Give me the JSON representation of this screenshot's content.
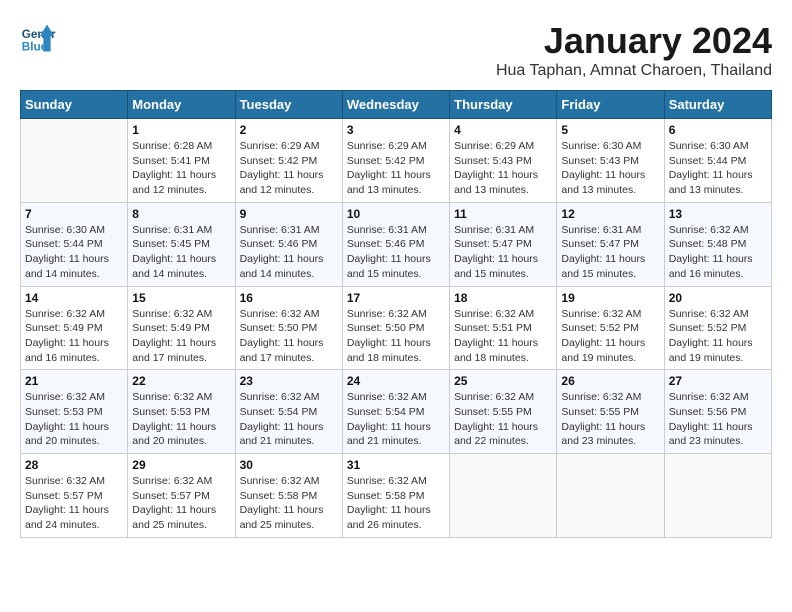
{
  "header": {
    "logo_line1": "General",
    "logo_line2": "Blue",
    "month": "January 2024",
    "location": "Hua Taphan, Amnat Charoen, Thailand"
  },
  "days_of_week": [
    "Sunday",
    "Monday",
    "Tuesday",
    "Wednesday",
    "Thursday",
    "Friday",
    "Saturday"
  ],
  "weeks": [
    [
      {
        "day": null
      },
      {
        "day": 1,
        "sunrise": "6:28 AM",
        "sunset": "5:41 PM",
        "daylight": "11 hours and 12 minutes."
      },
      {
        "day": 2,
        "sunrise": "6:29 AM",
        "sunset": "5:42 PM",
        "daylight": "11 hours and 12 minutes."
      },
      {
        "day": 3,
        "sunrise": "6:29 AM",
        "sunset": "5:42 PM",
        "daylight": "11 hours and 13 minutes."
      },
      {
        "day": 4,
        "sunrise": "6:29 AM",
        "sunset": "5:43 PM",
        "daylight": "11 hours and 13 minutes."
      },
      {
        "day": 5,
        "sunrise": "6:30 AM",
        "sunset": "5:43 PM",
        "daylight": "11 hours and 13 minutes."
      },
      {
        "day": 6,
        "sunrise": "6:30 AM",
        "sunset": "5:44 PM",
        "daylight": "11 hours and 13 minutes."
      }
    ],
    [
      {
        "day": 7,
        "sunrise": "6:30 AM",
        "sunset": "5:44 PM",
        "daylight": "11 hours and 14 minutes."
      },
      {
        "day": 8,
        "sunrise": "6:31 AM",
        "sunset": "5:45 PM",
        "daylight": "11 hours and 14 minutes."
      },
      {
        "day": 9,
        "sunrise": "6:31 AM",
        "sunset": "5:46 PM",
        "daylight": "11 hours and 14 minutes."
      },
      {
        "day": 10,
        "sunrise": "6:31 AM",
        "sunset": "5:46 PM",
        "daylight": "11 hours and 15 minutes."
      },
      {
        "day": 11,
        "sunrise": "6:31 AM",
        "sunset": "5:47 PM",
        "daylight": "11 hours and 15 minutes."
      },
      {
        "day": 12,
        "sunrise": "6:31 AM",
        "sunset": "5:47 PM",
        "daylight": "11 hours and 15 minutes."
      },
      {
        "day": 13,
        "sunrise": "6:32 AM",
        "sunset": "5:48 PM",
        "daylight": "11 hours and 16 minutes."
      }
    ],
    [
      {
        "day": 14,
        "sunrise": "6:32 AM",
        "sunset": "5:49 PM",
        "daylight": "11 hours and 16 minutes."
      },
      {
        "day": 15,
        "sunrise": "6:32 AM",
        "sunset": "5:49 PM",
        "daylight": "11 hours and 17 minutes."
      },
      {
        "day": 16,
        "sunrise": "6:32 AM",
        "sunset": "5:50 PM",
        "daylight": "11 hours and 17 minutes."
      },
      {
        "day": 17,
        "sunrise": "6:32 AM",
        "sunset": "5:50 PM",
        "daylight": "11 hours and 18 minutes."
      },
      {
        "day": 18,
        "sunrise": "6:32 AM",
        "sunset": "5:51 PM",
        "daylight": "11 hours and 18 minutes."
      },
      {
        "day": 19,
        "sunrise": "6:32 AM",
        "sunset": "5:52 PM",
        "daylight": "11 hours and 19 minutes."
      },
      {
        "day": 20,
        "sunrise": "6:32 AM",
        "sunset": "5:52 PM",
        "daylight": "11 hours and 19 minutes."
      }
    ],
    [
      {
        "day": 21,
        "sunrise": "6:32 AM",
        "sunset": "5:53 PM",
        "daylight": "11 hours and 20 minutes."
      },
      {
        "day": 22,
        "sunrise": "6:32 AM",
        "sunset": "5:53 PM",
        "daylight": "11 hours and 20 minutes."
      },
      {
        "day": 23,
        "sunrise": "6:32 AM",
        "sunset": "5:54 PM",
        "daylight": "11 hours and 21 minutes."
      },
      {
        "day": 24,
        "sunrise": "6:32 AM",
        "sunset": "5:54 PM",
        "daylight": "11 hours and 21 minutes."
      },
      {
        "day": 25,
        "sunrise": "6:32 AM",
        "sunset": "5:55 PM",
        "daylight": "11 hours and 22 minutes."
      },
      {
        "day": 26,
        "sunrise": "6:32 AM",
        "sunset": "5:55 PM",
        "daylight": "11 hours and 23 minutes."
      },
      {
        "day": 27,
        "sunrise": "6:32 AM",
        "sunset": "5:56 PM",
        "daylight": "11 hours and 23 minutes."
      }
    ],
    [
      {
        "day": 28,
        "sunrise": "6:32 AM",
        "sunset": "5:57 PM",
        "daylight": "11 hours and 24 minutes."
      },
      {
        "day": 29,
        "sunrise": "6:32 AM",
        "sunset": "5:57 PM",
        "daylight": "11 hours and 25 minutes."
      },
      {
        "day": 30,
        "sunrise": "6:32 AM",
        "sunset": "5:58 PM",
        "daylight": "11 hours and 25 minutes."
      },
      {
        "day": 31,
        "sunrise": "6:32 AM",
        "sunset": "5:58 PM",
        "daylight": "11 hours and 26 minutes."
      },
      {
        "day": null
      },
      {
        "day": null
      },
      {
        "day": null
      }
    ]
  ],
  "labels": {
    "sunrise_prefix": "Sunrise: ",
    "sunset_prefix": "Sunset: ",
    "daylight_prefix": "Daylight: "
  }
}
